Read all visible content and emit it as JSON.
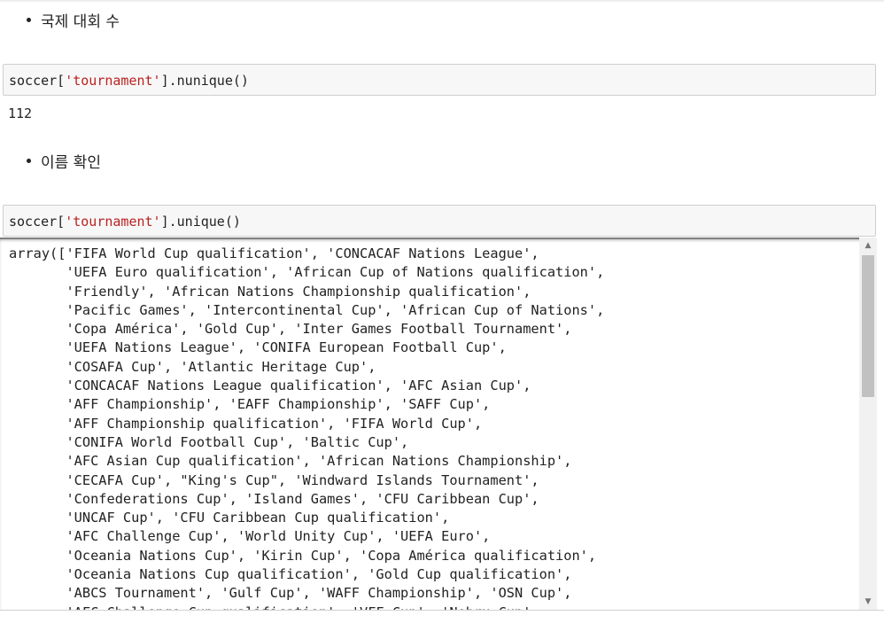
{
  "cells": {
    "bullet_count_label": "국제 대회 수",
    "code_nunique": {
      "prefix": "soccer[",
      "string": "'tournament'",
      "suffix": "].nunique()"
    },
    "output_nunique": "112",
    "bullet_names_label": "이름 확인",
    "code_unique": {
      "prefix": "soccer[",
      "string": "'tournament'",
      "suffix": "].unique()"
    },
    "output_unique_lines": [
      "array(['FIFA World Cup qualification', 'CONCACAF Nations League',",
      "       'UEFA Euro qualification', 'African Cup of Nations qualification',",
      "       'Friendly', 'African Nations Championship qualification',",
      "       'Pacific Games', 'Intercontinental Cup', 'African Cup of Nations',",
      "       'Copa América', 'Gold Cup', 'Inter Games Football Tournament',",
      "       'UEFA Nations League', 'CONIFA European Football Cup',",
      "       'COSAFA Cup', 'Atlantic Heritage Cup',",
      "       'CONCACAF Nations League qualification', 'AFC Asian Cup',",
      "       'AFF Championship', 'EAFF Championship', 'SAFF Cup',",
      "       'AFF Championship qualification', 'FIFA World Cup',",
      "       'CONIFA World Football Cup', 'Baltic Cup',",
      "       'AFC Asian Cup qualification', 'African Nations Championship',",
      "       'CECAFA Cup', \"King's Cup\", 'Windward Islands Tournament',",
      "       'Confederations Cup', 'Island Games', 'CFU Caribbean Cup',",
      "       'UNCAF Cup', 'CFU Caribbean Cup qualification',",
      "       'AFC Challenge Cup', 'World Unity Cup', 'UEFA Euro',",
      "       'Oceania Nations Cup', 'Kirin Cup', 'Copa América qualification',",
      "       'Oceania Nations Cup qualification', 'Gold Cup qualification',",
      "       'ABCS Tournament', 'Gulf Cup', 'WAFF Championship', 'OSN Cup',",
      "       'AFC Challenge Cup qualification', 'VFF Cup', 'Nehru Cup',"
    ]
  },
  "icons": {
    "scroll_up": "scroll-up-arrow-icon",
    "scroll_down": "scroll-down-arrow-icon"
  },
  "colors": {
    "string_literal": "#ba2121",
    "code_background": "#f7f7f7"
  }
}
